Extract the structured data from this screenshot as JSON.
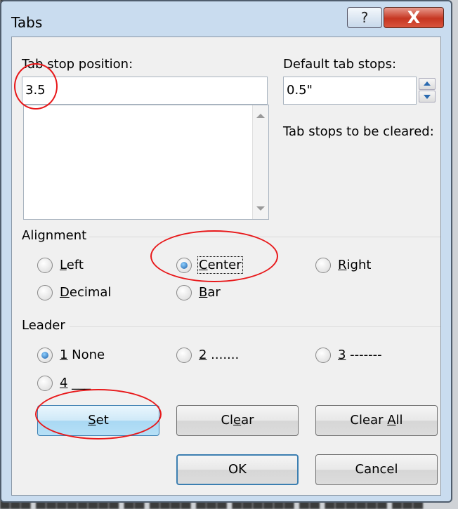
{
  "dialog": {
    "title": "Tabs",
    "help_label": "?",
    "close_label": "X"
  },
  "tab_stop_position": {
    "label": "Tab stop position:",
    "value": "3.5"
  },
  "default_tab_stops": {
    "label": "Default tab stops:",
    "value": "0.5\""
  },
  "to_be_cleared": {
    "label": "Tab stops to be cleared:"
  },
  "alignment": {
    "label": "Alignment",
    "options": [
      {
        "label": "Left",
        "checked": false
      },
      {
        "label": "Center",
        "checked": true
      },
      {
        "label": "Right",
        "checked": false
      },
      {
        "label": "Decimal",
        "checked": false
      },
      {
        "label": "Bar",
        "checked": false
      }
    ]
  },
  "leader": {
    "label": "Leader",
    "options": [
      {
        "label": "1 None",
        "checked": true
      },
      {
        "label": "2 .......",
        "checked": false
      },
      {
        "label": "3 -------",
        "checked": false
      },
      {
        "label": "4 ___",
        "checked": false
      }
    ]
  },
  "buttons": {
    "set": "Set",
    "clear": "Clear",
    "clear_all": "Clear All",
    "ok": "OK",
    "cancel": "Cancel"
  },
  "colors": {
    "annotation": "#e8181a",
    "radio_selected": "#1d5fa8",
    "close_button": "#c63622"
  }
}
